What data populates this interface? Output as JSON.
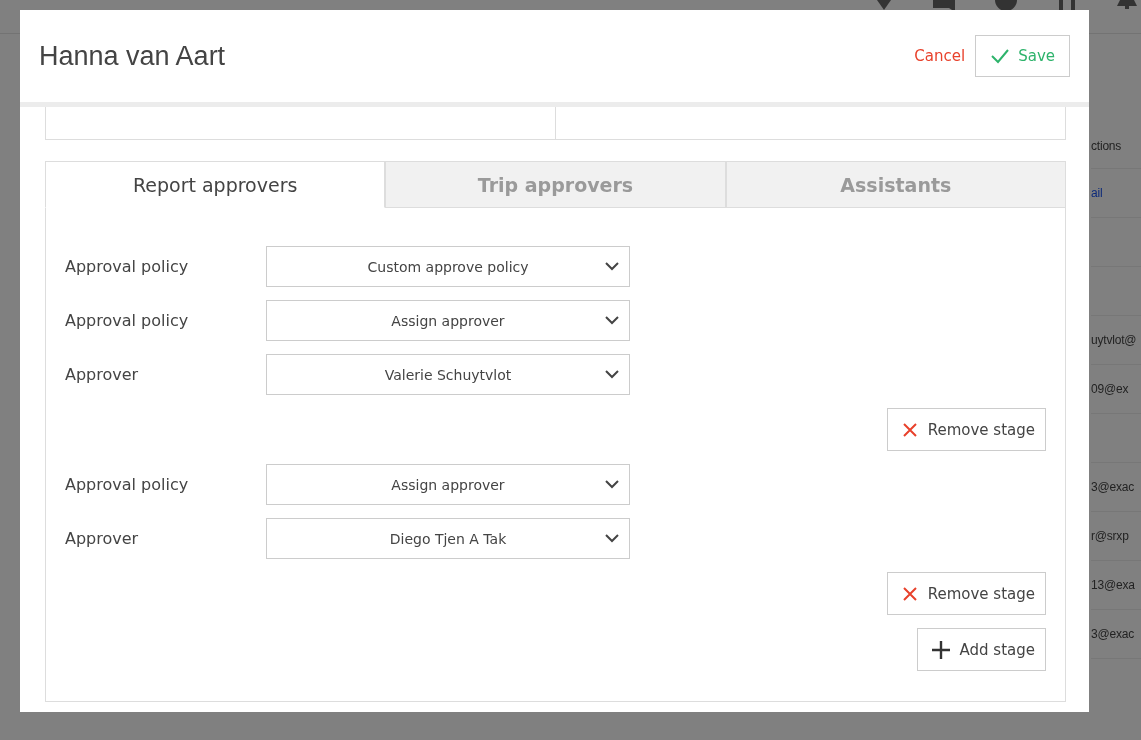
{
  "background": {
    "table_fragments": [
      {
        "kind": "header",
        "text": "ctions"
      },
      {
        "kind": "link",
        "text": "ail"
      },
      {
        "kind": "blank"
      },
      {
        "kind": "blank"
      },
      {
        "kind": "text",
        "text": "uytvlot@"
      },
      {
        "kind": "text",
        "text": "09@ex"
      },
      {
        "kind": "blank"
      },
      {
        "kind": "text",
        "text": "3@exac"
      },
      {
        "kind": "text",
        "text": "r@srxp"
      },
      {
        "kind": "text",
        "text": "13@exa"
      },
      {
        "kind": "text",
        "text": "3@exac"
      }
    ]
  },
  "modal": {
    "title": "Hanna van Aart",
    "cancel": "Cancel",
    "save": "Save",
    "tabs": [
      {
        "label": "Report approvers",
        "selected": true
      },
      {
        "label": "Trip approvers",
        "selected": false
      },
      {
        "label": "Assistants",
        "selected": false
      }
    ],
    "rows": [
      {
        "kind": "select",
        "label": "Approval policy",
        "value": "Custom approve policy"
      },
      {
        "kind": "select",
        "label": "Approval policy",
        "value": "Assign approver"
      },
      {
        "kind": "select",
        "label": "Approver",
        "value": "Valerie Schuytvlot"
      },
      {
        "kind": "remove",
        "label": "Remove stage"
      },
      {
        "kind": "select",
        "label": "Approval policy",
        "value": "Assign approver"
      },
      {
        "kind": "select",
        "label": "Approver",
        "value": "Diego Tjen A Tak"
      },
      {
        "kind": "remove",
        "label": "Remove stage"
      },
      {
        "kind": "add",
        "label": "Add stage"
      }
    ]
  }
}
